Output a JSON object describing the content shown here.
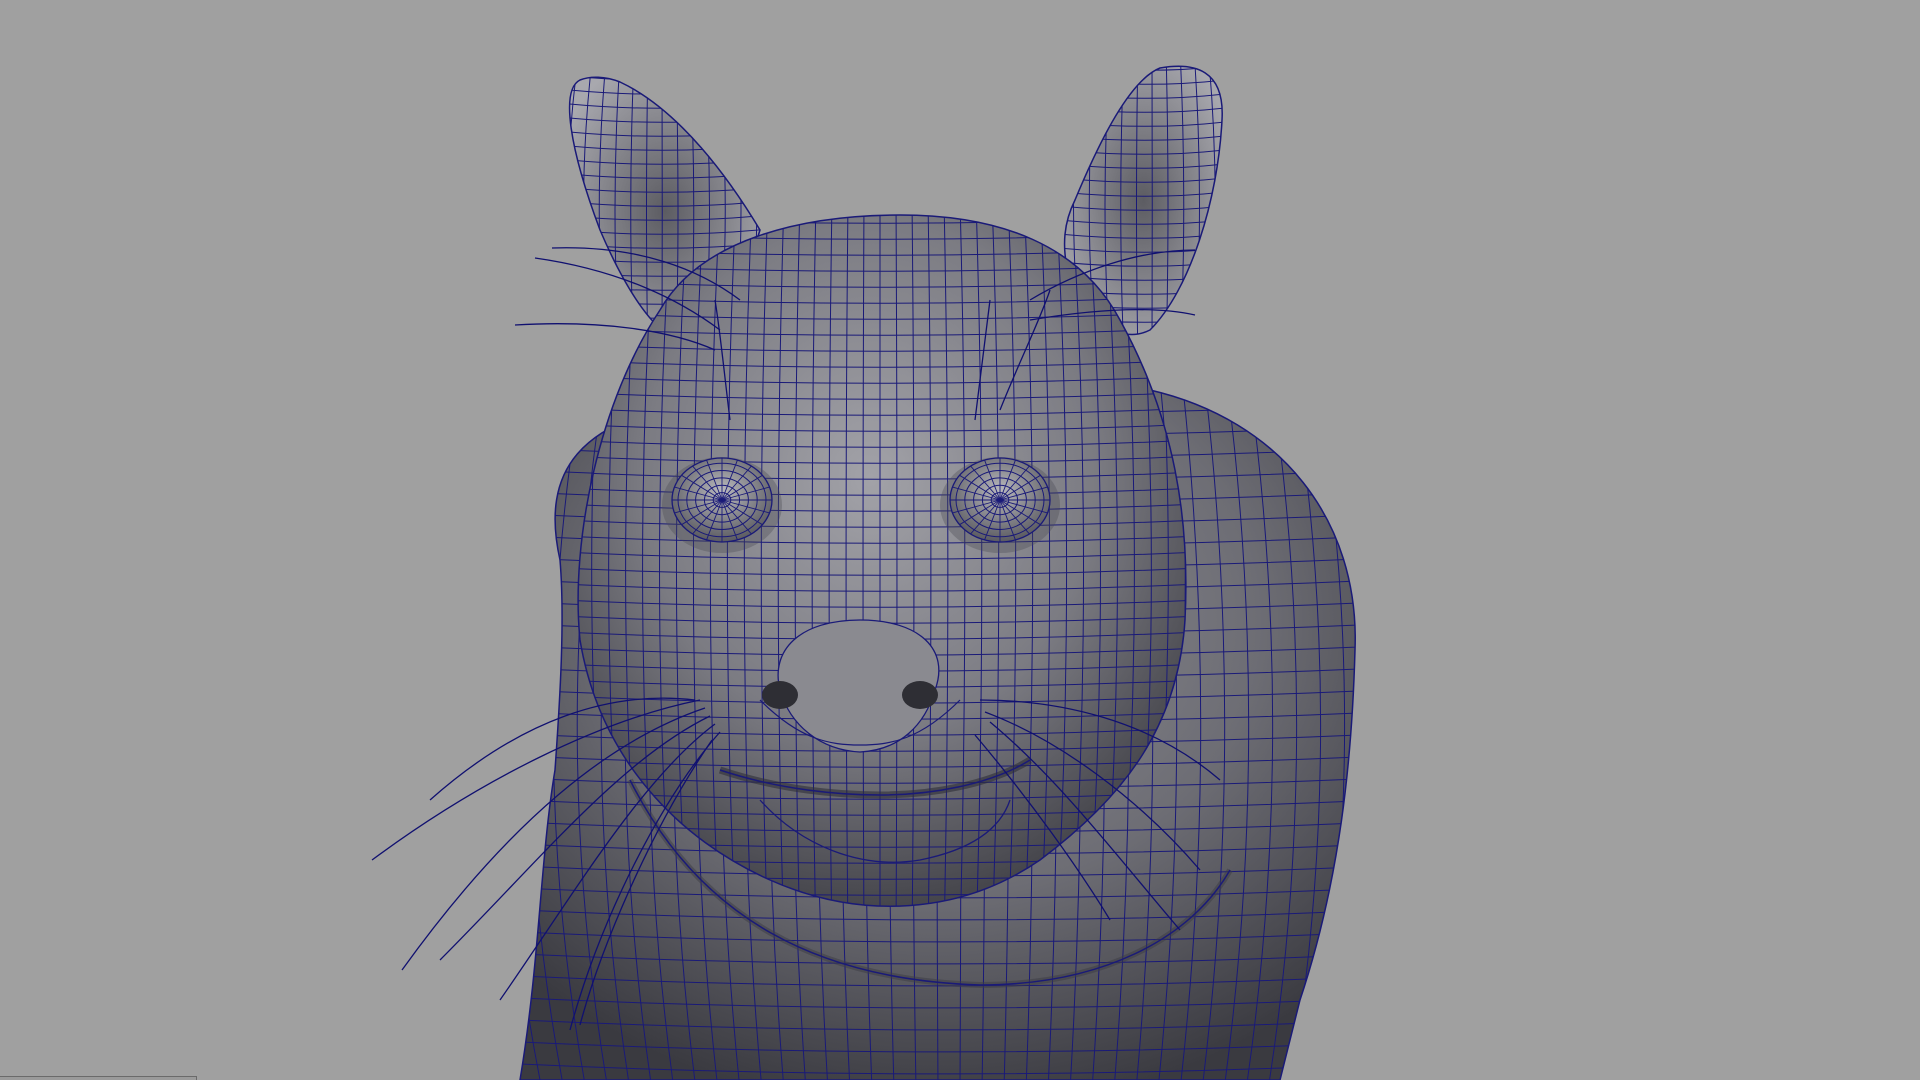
{
  "viewport": {
    "panel": "perspective-viewport",
    "shading": "smooth-shaded-with-wireframe",
    "model": "chinchilla-character-mesh",
    "background_color": "#a0a0a0",
    "wire_color": "#1a1a78",
    "mesh_color": "#6a6a72"
  }
}
